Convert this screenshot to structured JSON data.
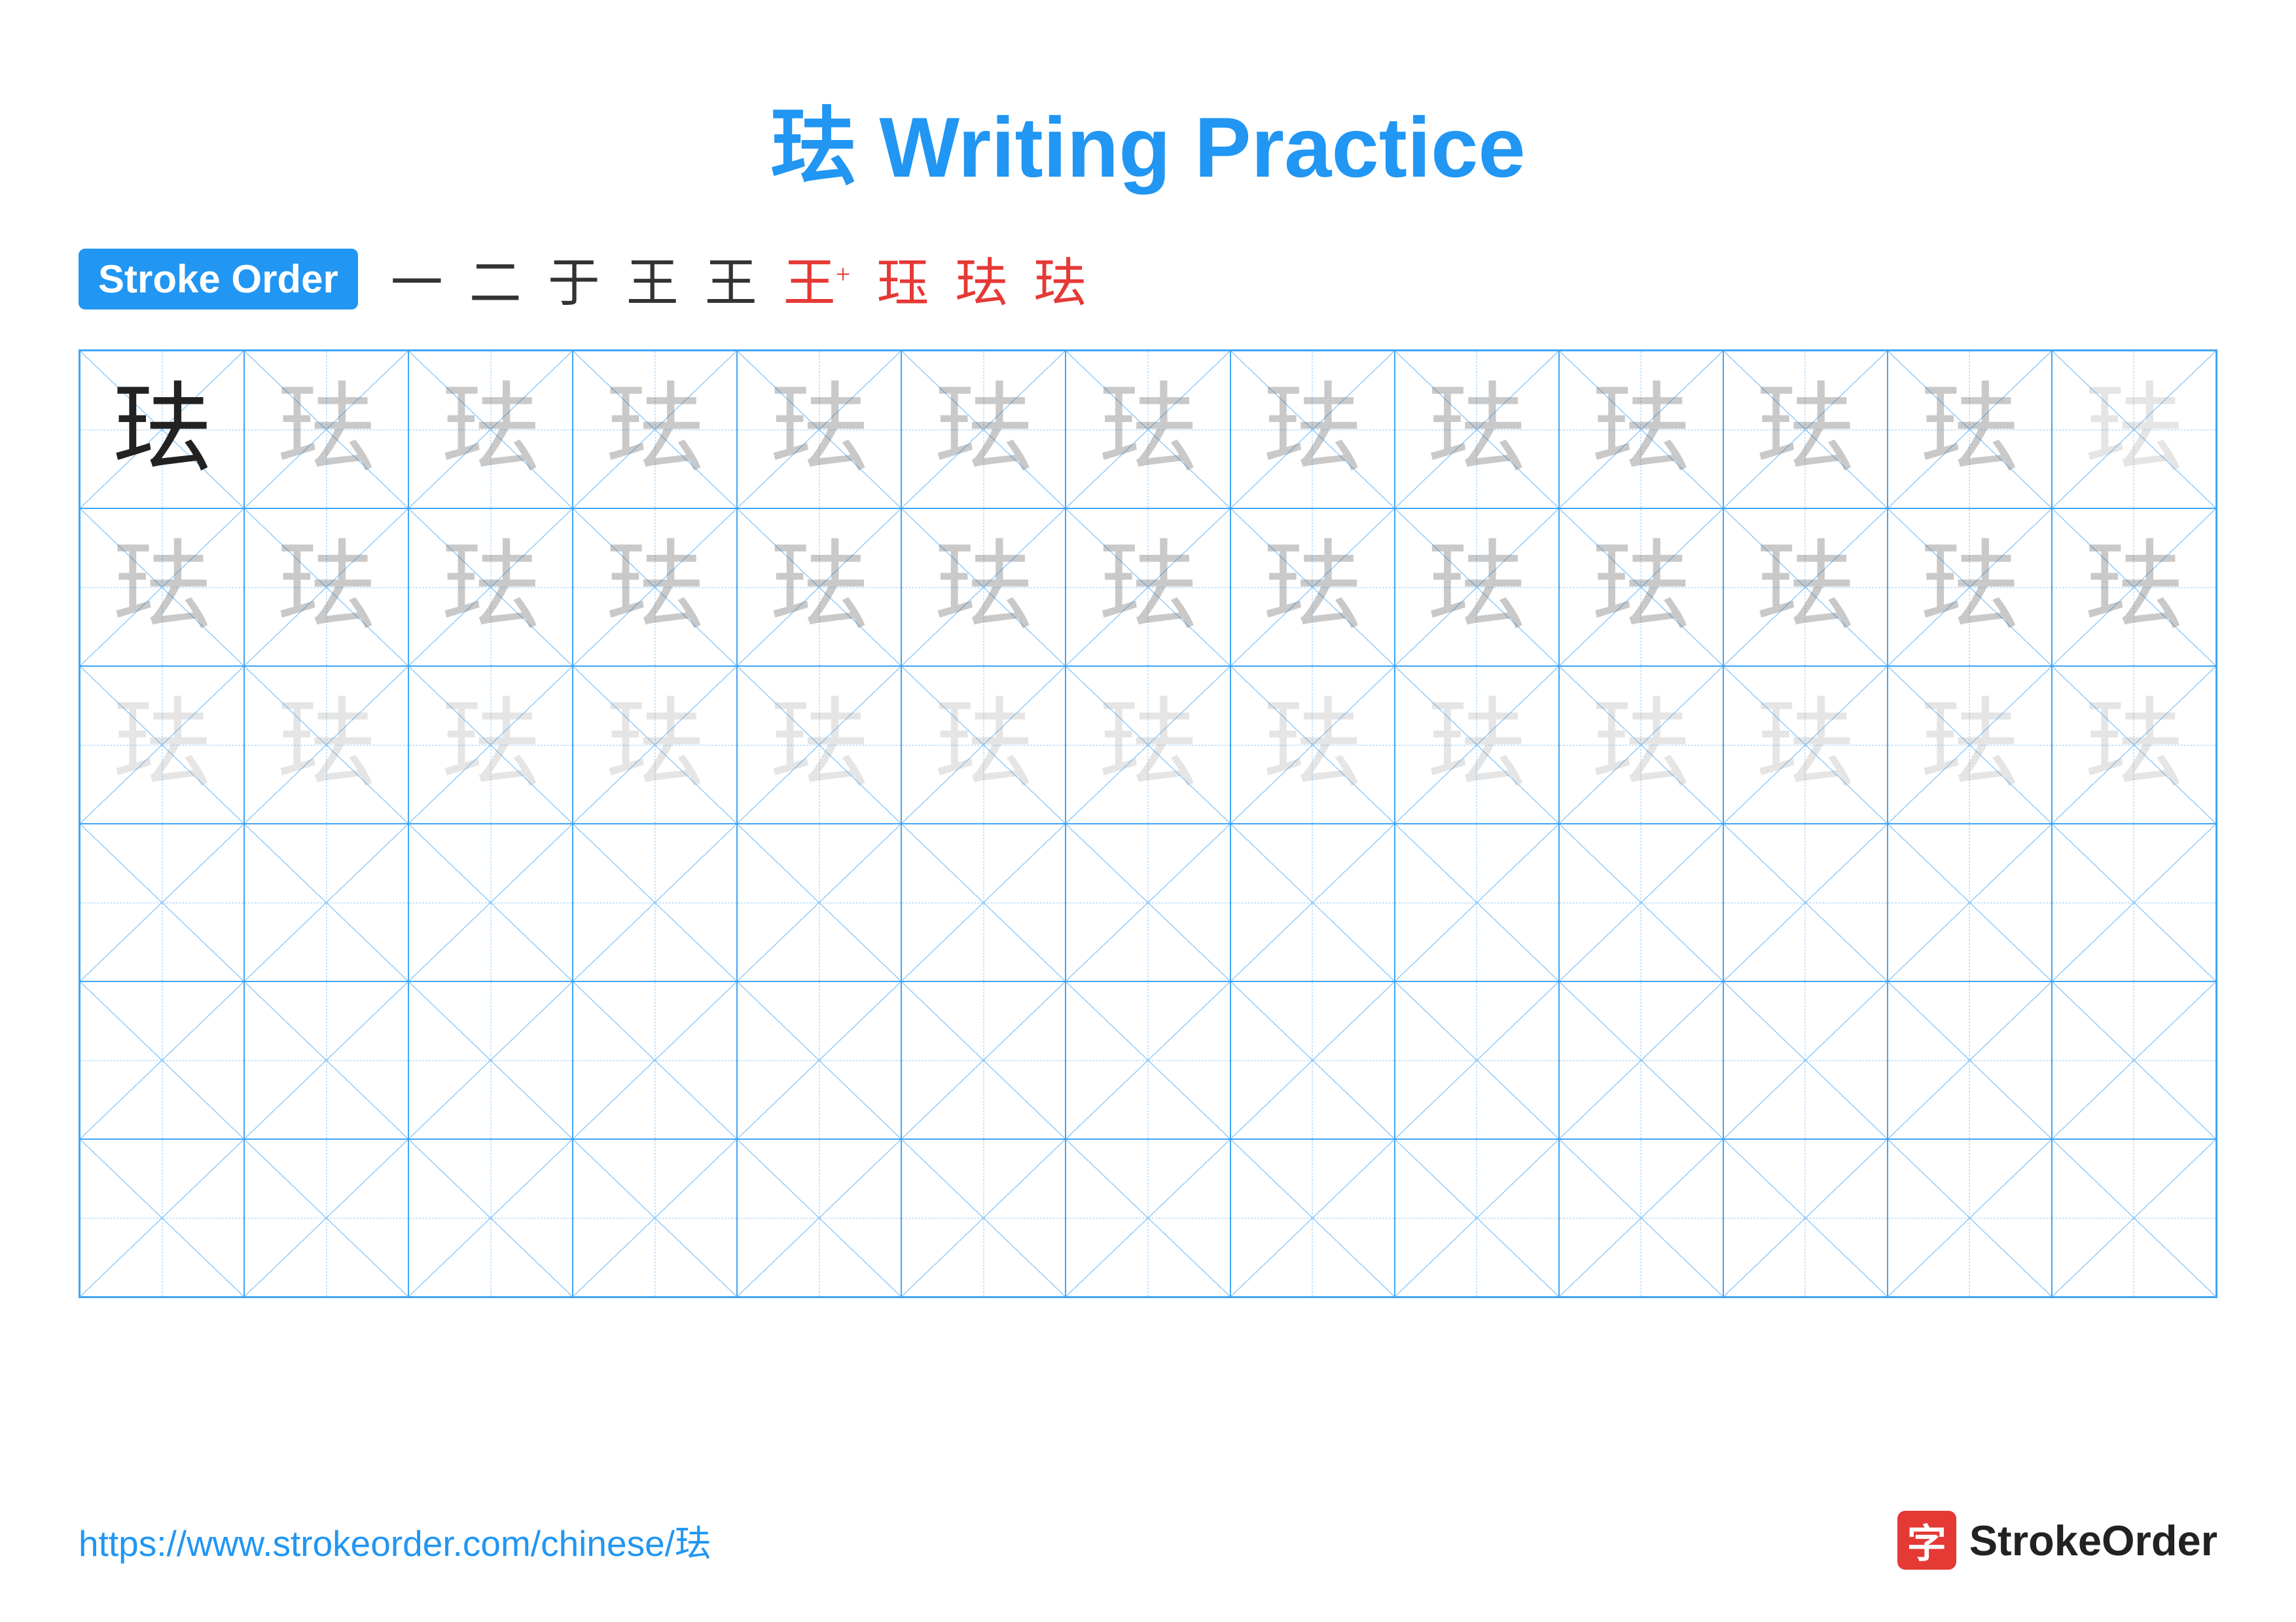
{
  "title": {
    "text": "珐 Writing Practice"
  },
  "stroke_order": {
    "badge_label": "Stroke Order",
    "steps": [
      "一",
      "二",
      "于",
      "王",
      "王⁻",
      "王⁺",
      "珏",
      "珐̃",
      "珐"
    ],
    "steps_display": [
      "㇐",
      "⼆",
      "于",
      "王",
      "王",
      "王",
      "珏",
      "珐",
      "珐"
    ]
  },
  "grid": {
    "rows": 6,
    "cols": 13,
    "character": "珐"
  },
  "footer": {
    "url": "https://www.strokeorder.com/chinese/珐",
    "logo_char": "字",
    "logo_name": "StrokeOrder"
  }
}
